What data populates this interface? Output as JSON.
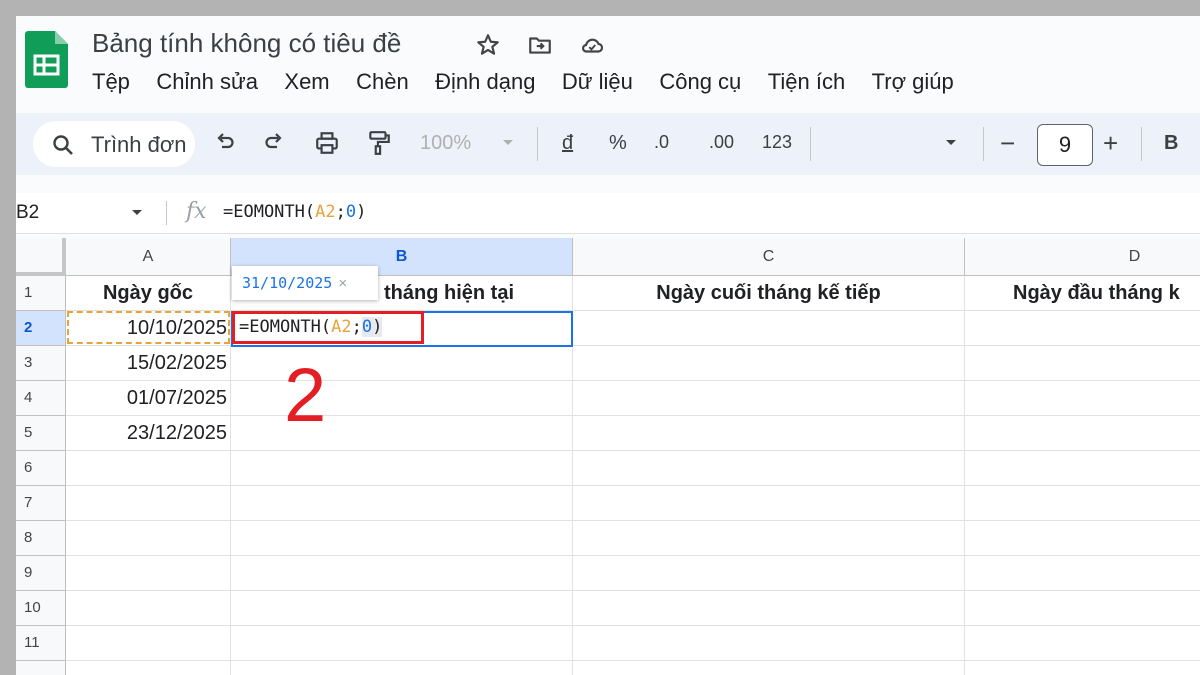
{
  "app": {
    "doc_title": "Bảng tính không có tiêu đề",
    "title_icons": [
      "star-icon",
      "move-folder-icon",
      "cloud-status-icon"
    ],
    "brand_color": "#0f9d58"
  },
  "menu": [
    "Tệp",
    "Chỉnh sửa",
    "Xem",
    "Chèn",
    "Định dạng",
    "Dữ liệu",
    "Công cụ",
    "Tiện ích",
    "Trợ giúp"
  ],
  "toolbar": {
    "search_placeholder": "Trình đơn",
    "zoom": "100%",
    "currency": "đ",
    "percent": "%",
    "decrease_decimal": ".0",
    "increase_decimal": ".00",
    "number_format": "123",
    "font_size": "9",
    "minus": "−",
    "plus": "+",
    "bold": "B"
  },
  "formula_bar": {
    "cell_ref": "B2",
    "fx": "fx",
    "formula_prefix": "=EOMONTH(",
    "formula_ref": "A2",
    "formula_sep": ";",
    "formula_num": "0",
    "formula_suffix": ")"
  },
  "grid": {
    "columns": [
      "A",
      "B",
      "C",
      "D"
    ],
    "rows": [
      "1",
      "2",
      "3",
      "4",
      "5",
      "6",
      "7",
      "8",
      "9",
      "10",
      "11"
    ],
    "header_row": [
      "Ngày gốc",
      "tháng hiện tại",
      "Ngày cuối tháng kế tiếp",
      "Ngày đầu tháng k"
    ],
    "dates": [
      "10/10/2025",
      "15/02/2025",
      "01/07/2025",
      "23/12/2025"
    ],
    "selected_column": "B",
    "selected_row": "2"
  },
  "tooltip": {
    "value": "31/10/2025",
    "close": "×"
  },
  "edit": {
    "prefix": "=EOMONTH(",
    "ref": "A2",
    "sep": ";",
    "num": "0",
    "suffix": ")"
  },
  "annotation": {
    "step": "2",
    "color": "#e31e24"
  }
}
